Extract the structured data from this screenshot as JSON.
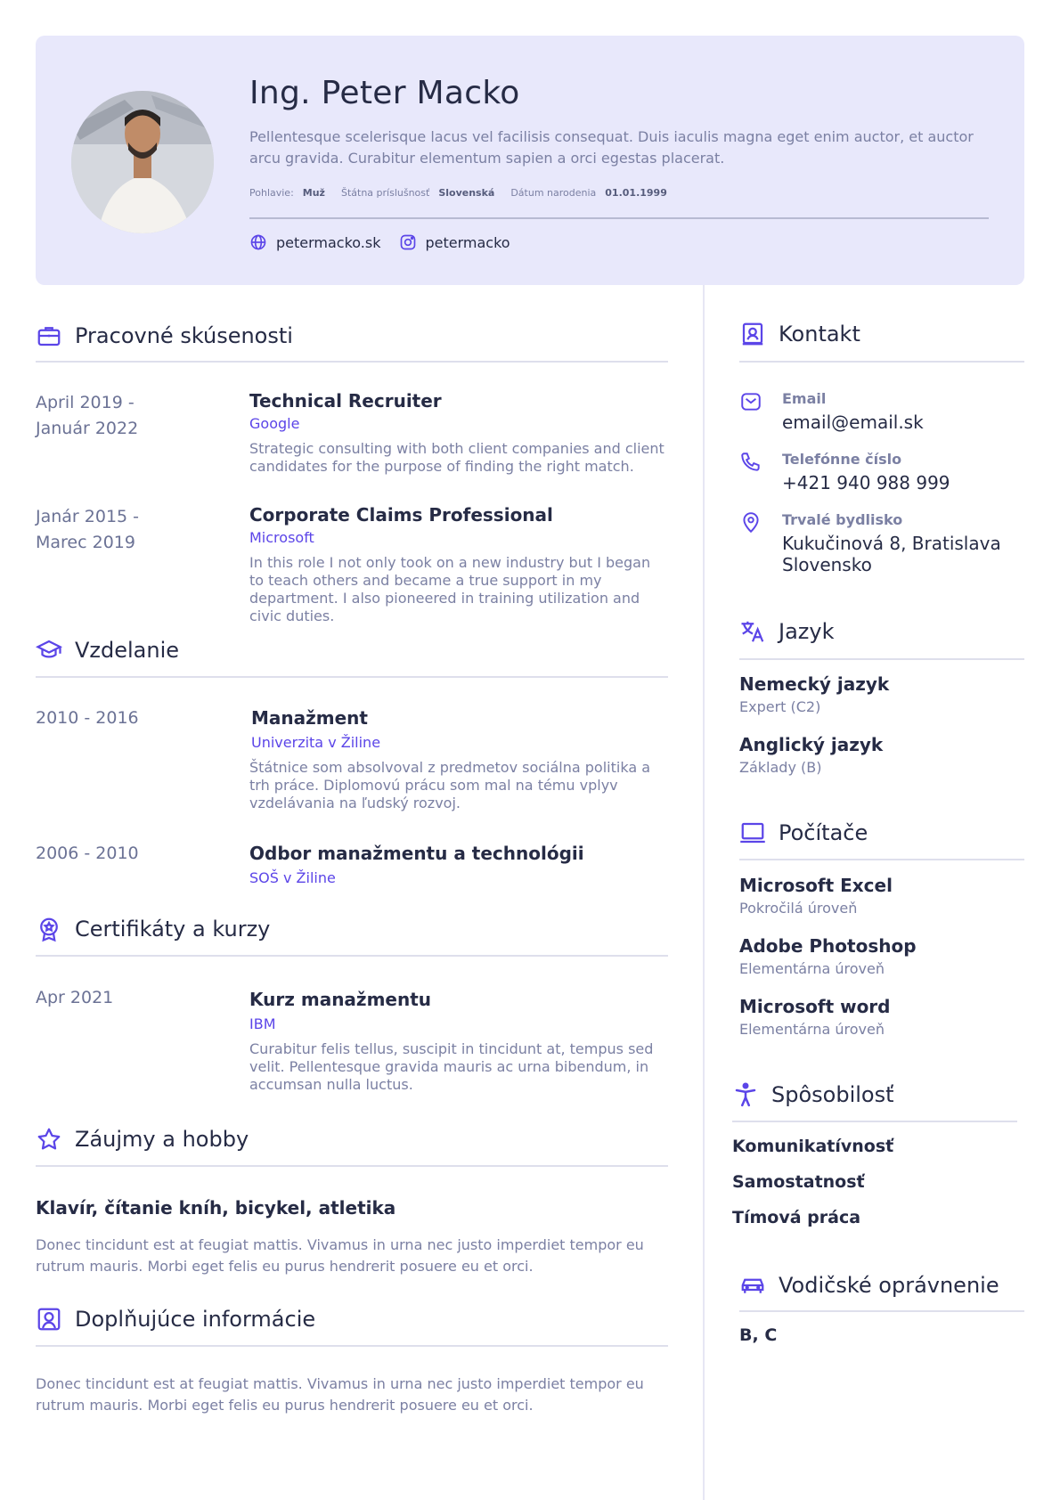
{
  "header": {
    "name": "Ing. Peter Macko",
    "summary": "Pellentesque scelerisque lacus vel facilisis consequat. Duis iaculis magna eget enim auctor, et auctor arcu gravida. Curabitur elementum sapien a orci egestas placerat.",
    "personal": [
      {
        "label": "Pohlavie:",
        "value": "Muž"
      },
      {
        "label": "Štátna príslušnosť",
        "value": "Slovenská"
      },
      {
        "label": "Dátum narodenia",
        "value": "01.01.1999"
      }
    ],
    "website": "petermacko.sk",
    "instagram": "petermacko"
  },
  "experience": {
    "title": "Pracovné skúsenosti",
    "items": [
      {
        "date": "April 2019 -\nJanuár 2022",
        "title": "Technical Recruiter",
        "org": "Google",
        "desc": "Strategic consulting with both client companies and client candidates for the purpose of finding the right match."
      },
      {
        "date": "Janár 2015 -\nMarec 2019",
        "title": "Corporate Claims Professional",
        "org": "Microsoft",
        "desc": "In this role I not only took on a new industry but I began to teach others and became a true support in my department. I also pioneered in training utilization and civic duties."
      }
    ]
  },
  "education": {
    "title": "Vzdelanie",
    "items": [
      {
        "date": "2010 - 2016",
        "title": "Manažment",
        "org": "Univerzita v Žiline",
        "desc": "Štátnice som absolvoval z predmetov sociálna politika a trh práce. Diplomovú prácu som mal na tému vplyv vzdelávania na ľudský rozvoj."
      },
      {
        "date": "2006 - 2010",
        "title": "Odbor manažmentu a technológii",
        "org": "SOŠ v Žiline",
        "desc": ""
      }
    ]
  },
  "certificates": {
    "title": "Certifikáty a kurzy",
    "items": [
      {
        "date": "Apr 2021",
        "title": "Kurz manažmentu",
        "org": "IBM",
        "desc": "Curabitur felis tellus, suscipit in tincidunt at, tempus sed velit. Pellentesque gravida mauris ac urna bibendum, in accumsan nulla luctus."
      }
    ]
  },
  "hobbies": {
    "title": "Záujmy a hobby",
    "headline": "Klavír, čítanie kníh, bicykel, atletika",
    "text": "Donec tincidunt est at feugiat mattis. Vivamus in urna nec justo imperdiet tempor eu rutrum mauris. Morbi eget felis eu purus hendrerit posuere eu et orci."
  },
  "additional": {
    "title": "Doplňujúce informácie",
    "text": "Donec tincidunt est at feugiat mattis. Vivamus in urna nec justo imperdiet tempor eu rutrum mauris. Morbi eget felis eu purus hendrerit posuere eu et orci."
  },
  "contact": {
    "title": "Kontakt",
    "email_label": "Email",
    "email": "email@email.sk",
    "phone_label": "Telefónne číslo",
    "phone": "+421 940 988 999",
    "address_label": "Trvalé bydlisko",
    "address": "Kukučinová 8, Bratislava\nSlovensko"
  },
  "languages": {
    "title": "Jazyk",
    "items": [
      {
        "name": "Nemecký jazyk",
        "level": "Expert (C2)"
      },
      {
        "name": "Anglický jazyk",
        "level": "Základy (B)"
      }
    ]
  },
  "computers": {
    "title": "Počítače",
    "items": [
      {
        "name": "Microsoft Excel",
        "level": "Pokročilá úroveň"
      },
      {
        "name": "Adobe Photoshop",
        "level": "Elementárna úroveň"
      },
      {
        "name": "Microsoft word",
        "level": "Elementárna úroveň"
      }
    ]
  },
  "abilities": {
    "title": "Spôsobilosť",
    "items": [
      "Komunikatívnosť",
      "Samostatnosť",
      "Tímová práca"
    ]
  },
  "driving": {
    "title": "Vodičské oprávnenie",
    "value": "B, C"
  },
  "icons": [
    "globe-icon",
    "instagram-icon",
    "briefcase-icon",
    "graduation-cap-icon",
    "award-icon",
    "star-icon",
    "user-square-icon",
    "contact-card-icon",
    "mail-icon",
    "phone-icon",
    "map-pin-icon",
    "translate-icon",
    "laptop-icon",
    "accessibility-icon",
    "car-icon"
  ],
  "colors": {
    "accent": "#5b45e8",
    "header_bg": "#e8e8fb",
    "text": "#262b45",
    "muted": "#7b80a3"
  }
}
